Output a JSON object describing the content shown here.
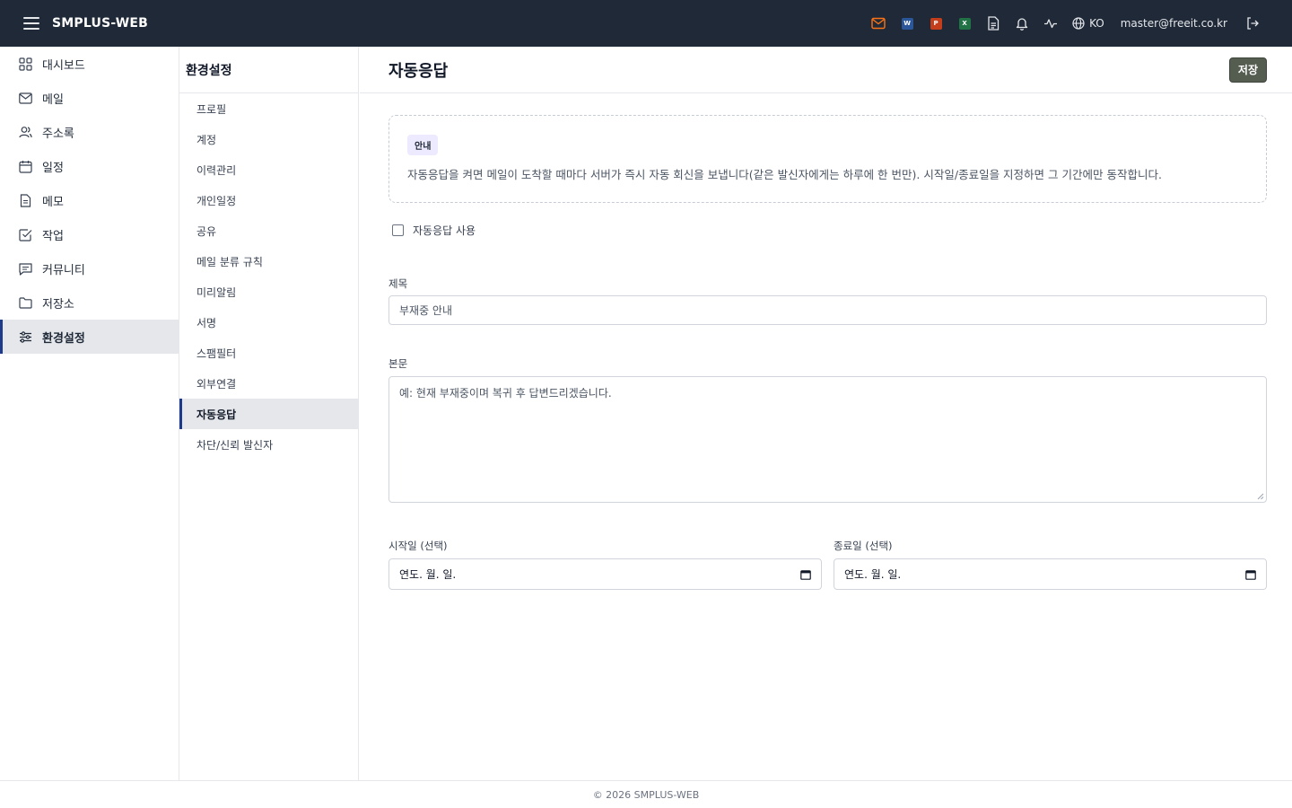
{
  "app": {
    "brand": "SMPLUS-WEB"
  },
  "topbar": {
    "icons": [
      "mail-icon",
      "word-icon",
      "powerpoint-icon",
      "excel-icon",
      "document-icon",
      "bell-icon",
      "activity-icon",
      "globe-icon",
      "logout-icon"
    ],
    "office_letters": {
      "word": "W",
      "powerpoint": "P",
      "excel": "X"
    },
    "colors": {
      "mail": "#f97316",
      "word": "#2b579a",
      "powerpoint": "#c43e1c",
      "excel": "#217346",
      "bar_bg": "#1f2937"
    },
    "lang": "KO",
    "user": "master@freeit.co.kr"
  },
  "leftnav": {
    "items": [
      {
        "label": "대시보드",
        "icon": "grid-icon"
      },
      {
        "label": "메일",
        "icon": "mail-icon"
      },
      {
        "label": "주소록",
        "icon": "users-icon"
      },
      {
        "label": "일정",
        "icon": "calendar-icon"
      },
      {
        "label": "메모",
        "icon": "document-icon"
      },
      {
        "label": "작업",
        "icon": "checkbox-icon"
      },
      {
        "label": "커뮤니티",
        "icon": "message-icon"
      },
      {
        "label": "저장소",
        "icon": "folder-icon"
      },
      {
        "label": "환경설정",
        "icon": "sliders-icon"
      }
    ],
    "active_index": 8
  },
  "subnav": {
    "title": "환경설정",
    "items": [
      "프로필",
      "계정",
      "이력관리",
      "개인일정",
      "공유",
      "메일 분류 규칙",
      "미리알림",
      "서명",
      "스팸필터",
      "외부연결",
      "자동응답",
      "차단/신뢰 발신자"
    ],
    "active_index": 10
  },
  "main": {
    "title": "자동응답",
    "save_label": "저장",
    "notice": {
      "badge": "안내",
      "text": "자동응답을 켜면 메일이 도착할 때마다 서버가 즉시 자동 회신을 보냅니다(같은 발신자에게는 하루에 한 번만). 시작일/종료일을 지정하면 그 기간에만 동작합니다."
    },
    "enable_label": "자동응답 사용",
    "enable_checked": false,
    "subject": {
      "label": "제목",
      "placeholder": "부재중 안내"
    },
    "body": {
      "label": "본문",
      "placeholder": "예: 현재 부재중이며 복귀 후 답변드리겠습니다."
    },
    "start": {
      "label": "시작일 (선택)",
      "value": "연도. 월. 일."
    },
    "end": {
      "label": "종료일 (선택)",
      "value": "연도. 월. 일."
    }
  },
  "footer": {
    "text": "© 2026 SMPLUS-WEB"
  },
  "colors": {
    "accent": "#1e3a8a",
    "save_button": "#555d50",
    "badge_bg": "#ede9fe"
  }
}
